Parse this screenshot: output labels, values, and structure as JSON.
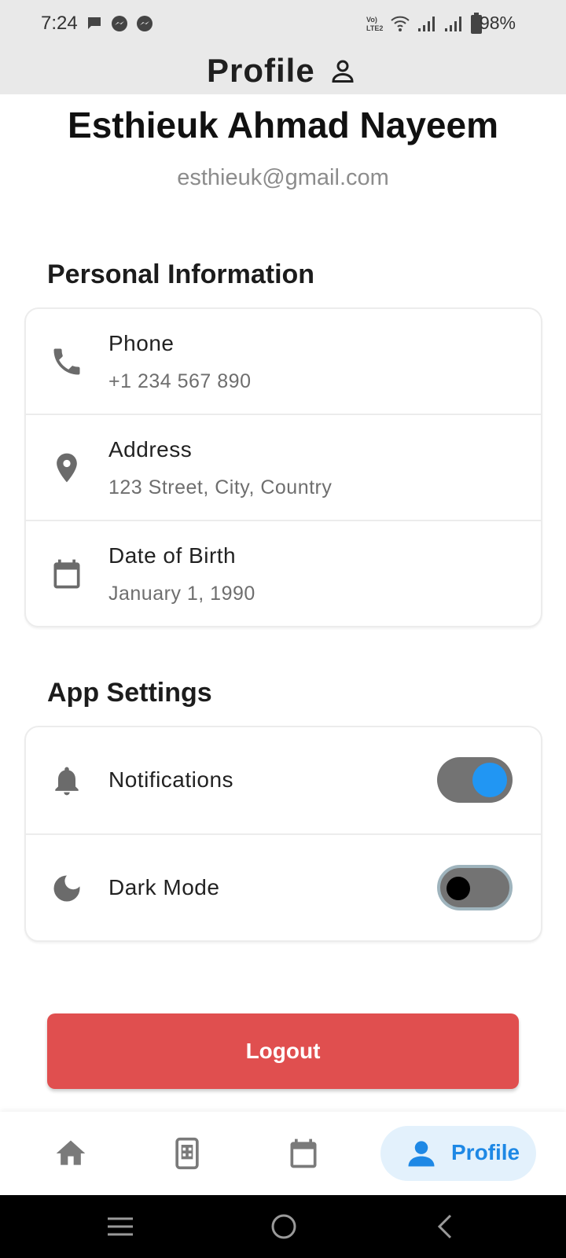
{
  "status_bar": {
    "time": "7:24",
    "battery": "98%",
    "network": "VoLTE2"
  },
  "header": {
    "title": "Profile",
    "icon": "person-outline-icon"
  },
  "user": {
    "name": "Esthieuk Ahmad Nayeem",
    "email": "esthieuk@gmail.com"
  },
  "personal_info": {
    "title": "Personal Information",
    "items": [
      {
        "label": "Phone",
        "value": "+1 234 567 890",
        "icon": "phone-icon"
      },
      {
        "label": "Address",
        "value": "123 Street, City, Country",
        "icon": "location-pin-icon"
      },
      {
        "label": "Date of Birth",
        "value": "January 1, 1990",
        "icon": "calendar-icon"
      }
    ]
  },
  "app_settings": {
    "title": "App Settings",
    "items": [
      {
        "label": "Notifications",
        "enabled": true,
        "icon": "bell-icon"
      },
      {
        "label": "Dark Mode",
        "enabled": false,
        "icon": "moon-icon"
      }
    ]
  },
  "logout": {
    "label": "Logout",
    "color": "#e04f4f"
  },
  "bottom_nav": {
    "items": [
      {
        "icon": "home-icon"
      },
      {
        "icon": "phone-calculator-icon"
      },
      {
        "icon": "calendar-icon"
      },
      {
        "icon": "person-icon",
        "label": "Profile",
        "active": true
      }
    ]
  },
  "colors": {
    "accent": "#2196f3",
    "danger": "#e04f4f",
    "header_bg": "#e9e9e9"
  }
}
